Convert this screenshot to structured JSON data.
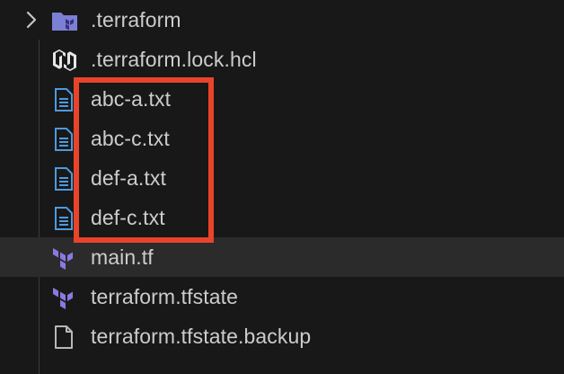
{
  "explorer": {
    "items": [
      {
        "name": ".terraform",
        "kind": "folder",
        "icon": "terraform-folder-icon"
      },
      {
        "name": ".terraform.lock.hcl",
        "kind": "file",
        "icon": "hcl-icon"
      },
      {
        "name": "abc-a.txt",
        "kind": "file",
        "icon": "text-file-icon"
      },
      {
        "name": "abc-c.txt",
        "kind": "file",
        "icon": "text-file-icon"
      },
      {
        "name": "def-a.txt",
        "kind": "file",
        "icon": "text-file-icon"
      },
      {
        "name": "def-c.txt",
        "kind": "file",
        "icon": "text-file-icon"
      },
      {
        "name": "main.tf",
        "kind": "file",
        "icon": "terraform-icon",
        "selected": true
      },
      {
        "name": "terraform.tfstate",
        "kind": "file",
        "icon": "terraform-icon"
      },
      {
        "name": "terraform.tfstate.backup",
        "kind": "file",
        "icon": "generic-file-icon"
      }
    ]
  },
  "colors": {
    "background": "#181818",
    "selected_row": "#2b2b2b",
    "text": "#cccccc",
    "folder_purple": "#7b7fd6",
    "terraform_purple": "#8c78e0",
    "text_file_blue": "#4c9ae0",
    "highlight_box": "#e8442a"
  }
}
